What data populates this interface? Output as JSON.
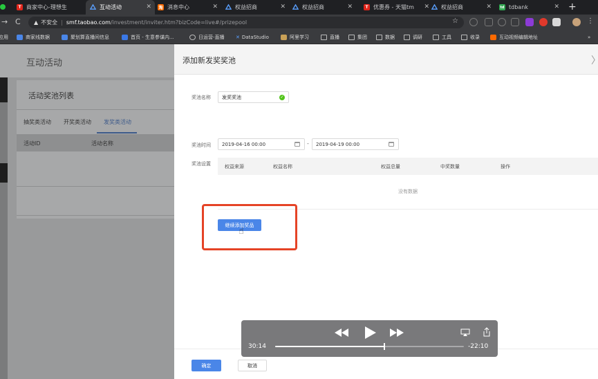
{
  "browser": {
    "tabs": [
      {
        "title": "商家中心-理想生",
        "icon": "tmall-icon",
        "icon_text": "T",
        "active": false
      },
      {
        "title": "互动活动",
        "icon": "alibaba-icon",
        "active": true
      },
      {
        "title": "消息中心",
        "icon": "taobao-icon",
        "icon_text": "淘",
        "active": false
      },
      {
        "title": "权益招商",
        "icon": "alibaba-icon",
        "active": false
      },
      {
        "title": "权益招商",
        "icon": "alibaba-icon",
        "active": false
      },
      {
        "title": "优惠券 - 天猫tm",
        "icon": "tmall-icon",
        "icon_text": "T",
        "active": false
      },
      {
        "title": "权益招商",
        "icon": "alibaba-icon",
        "active": false
      },
      {
        "title": "tdbank",
        "icon": "td-icon",
        "icon_text": "td",
        "active": false
      }
    ],
    "security_label": "不安全",
    "url_host": "smf.taobao.com",
    "url_path": "/investment/inviter.htm?bizCode=live#/prizepool",
    "bookmarks": [
      {
        "label": "应用"
      },
      {
        "label": "商家线数据"
      },
      {
        "label": "聚划算直播间信息"
      },
      {
        "label": "首页 - 生意参谋内..."
      },
      {
        "label": "日运营-直播"
      },
      {
        "label": "DataStudio"
      },
      {
        "label": "阿里学习"
      },
      {
        "label": "直播"
      },
      {
        "label": "集团"
      },
      {
        "label": "数据"
      },
      {
        "label": "调研"
      },
      {
        "label": "工具"
      },
      {
        "label": "收录"
      },
      {
        "label": "互动视频编辑地址"
      }
    ]
  },
  "left": {
    "header_title": "互动活动",
    "card_title": "活动奖池列表",
    "tabs": [
      "抽奖类活动",
      "开奖类活动",
      "发奖类活动"
    ],
    "active_tab": 2,
    "columns": [
      "活动ID",
      "活动名称"
    ]
  },
  "drawer": {
    "title": "添加新发奖奖池",
    "name_label": "奖池名称",
    "name_value": "发奖奖池",
    "time_label": "奖池时间",
    "start_date": "2019-04-16 00:00",
    "end_date": "2019-04-19 00:00",
    "range_sep": "-",
    "settings_label": "奖池设置",
    "columns": [
      "权益来源",
      "权益名称",
      "权益总量",
      "中奖数量",
      "操作"
    ],
    "empty_text": "没有数据",
    "add_button": "继续添加奖品",
    "ok_button": "确定",
    "cancel_button": "取消"
  },
  "player": {
    "elapsed": "30:14",
    "remaining": "-22:10",
    "progress": 0.577
  },
  "colors": {
    "primary": "#4a86e8",
    "highlight_box": "#e54326",
    "success": "#52c41a"
  }
}
